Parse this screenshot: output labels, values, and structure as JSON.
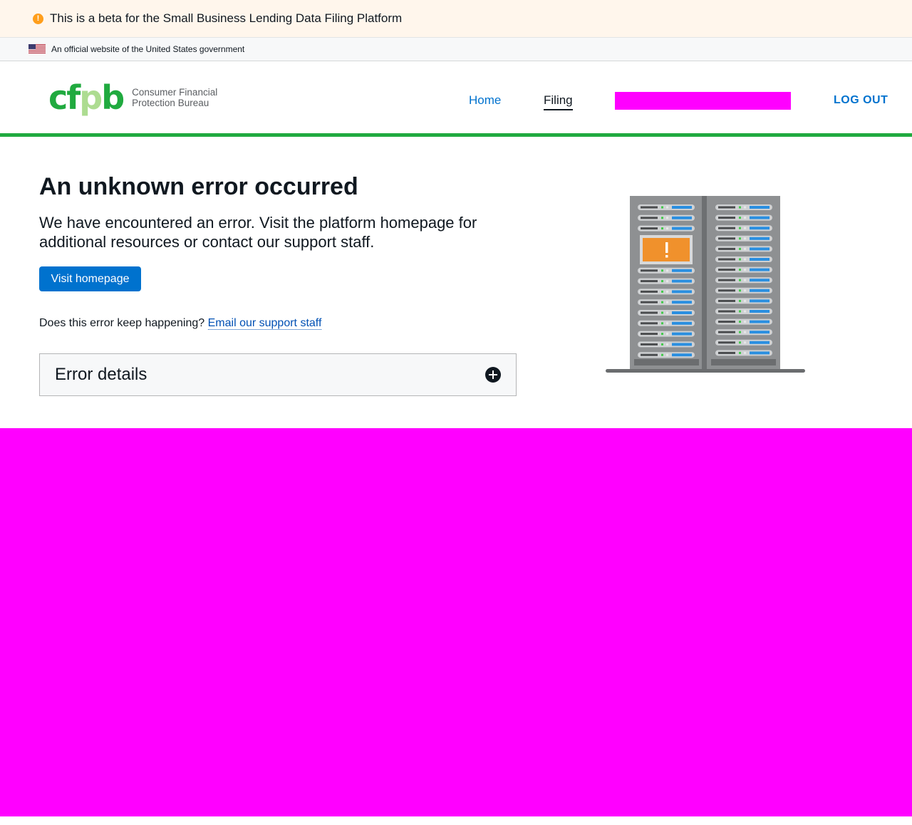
{
  "beta_banner": {
    "icon": "warning-icon",
    "text": "This is a beta for the Small Business Lending Data Filing Platform",
    "icon_color": "#ff9e1b"
  },
  "gov_banner": {
    "icon": "us-flag-icon",
    "text": "An official website of the United States government"
  },
  "header": {
    "logo_mark": "cfpb",
    "logo_text_line1": "Consumer Financial",
    "logo_text_line2": "Protection Bureau",
    "nav": [
      {
        "label": "Home",
        "active": false
      },
      {
        "label": "Filing",
        "active": true
      }
    ],
    "logout_label": "LOG OUT",
    "accent_color": "#20aa3f"
  },
  "main": {
    "title": "An unknown error occurred",
    "description": "We have encountered an error. Visit the platform homepage for additional resources or contact our support staff.",
    "visit_button_label": "Visit homepage",
    "support_prompt": "Does this error keep happening?",
    "support_link_label": "Email our support staff",
    "error_details_label": "Error details",
    "illustration": "server-rack-error-illustration"
  },
  "colors": {
    "primary": "#0072ce",
    "text": "#101820",
    "warning": "#ff9e1b",
    "redaction": "#ff00ff"
  }
}
